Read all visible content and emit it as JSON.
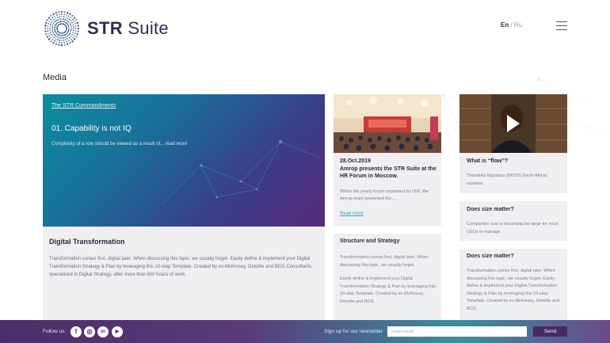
{
  "header": {
    "brand_bold": "STR",
    "brand_light": " Suite",
    "lang_active": "En",
    "lang_sep": " / ",
    "lang_other": "Ru"
  },
  "section_title": "Media",
  "feature": {
    "tag": "The STR Commandments",
    "title": "01. Capability is not IQ",
    "excerpt": "Complexity of a role should be viewed as a result of...",
    "read_more": "read more"
  },
  "digital": {
    "title": "Digital Transformation",
    "body": "Transformation comes first, digital later. When discussing this topic, we usually forget. Easily define & implement your Digital Transformation Strategy & Plan by leveraging this 10-step Template. Created by ex-McKinsey, Deloitte and BCG Consultants specialized in Digital Strategy, after more than 600 hours of work."
  },
  "news": {
    "date": "28.Oct.2019",
    "title": "Amrop presents the STR Suite at the HR Forum in Moscow.",
    "body": "Within the yearly forum organised by LBS, the Amrop team presented the ...",
    "read_more": "Read more"
  },
  "structure": {
    "title": "Structure and Strategy",
    "p1": "Transformation comes first, digital later. When discussing this topic, we usually forget.",
    "p2": "Easily define & implement your Digital Transformation Strategy & Plan by leveraging this 10-step Template. Created by ex-McKinsey, Deloitte and BCG"
  },
  "flow": {
    "title": "What is “flow”?",
    "body": "Thandeka Mgoduso (BIOSS South Africa) explains."
  },
  "size1": {
    "title": "Does size matter?",
    "body": "Companies' size is becoming too large for most CEOs to manage."
  },
  "size2": {
    "title": "Does size matter?",
    "body": "Transformation comes first, digital later. When discussing this topic, we usually forget. Easily define & implement your Digital Transformation Strategy & Plan by leveraging this 10-step Template. Created by ex-McKinsey, Deloitte and BCG"
  },
  "footer": {
    "follow_label": "Follow us",
    "social": [
      {
        "name": "facebook-icon",
        "glyph": "f"
      },
      {
        "name": "instagram-icon",
        "glyph": "◎"
      },
      {
        "name": "linkedin-icon",
        "glyph": "in"
      },
      {
        "name": "youtube-icon",
        "glyph": "▶"
      }
    ],
    "signup_label": "Sign up for our newsletter",
    "email_placeholder": "Insert email",
    "send_label": "Send"
  },
  "colors": {
    "brand_purple": "#3a2a55",
    "footer_purple": "#4a2e6a",
    "teal": "#3aa0a8"
  }
}
